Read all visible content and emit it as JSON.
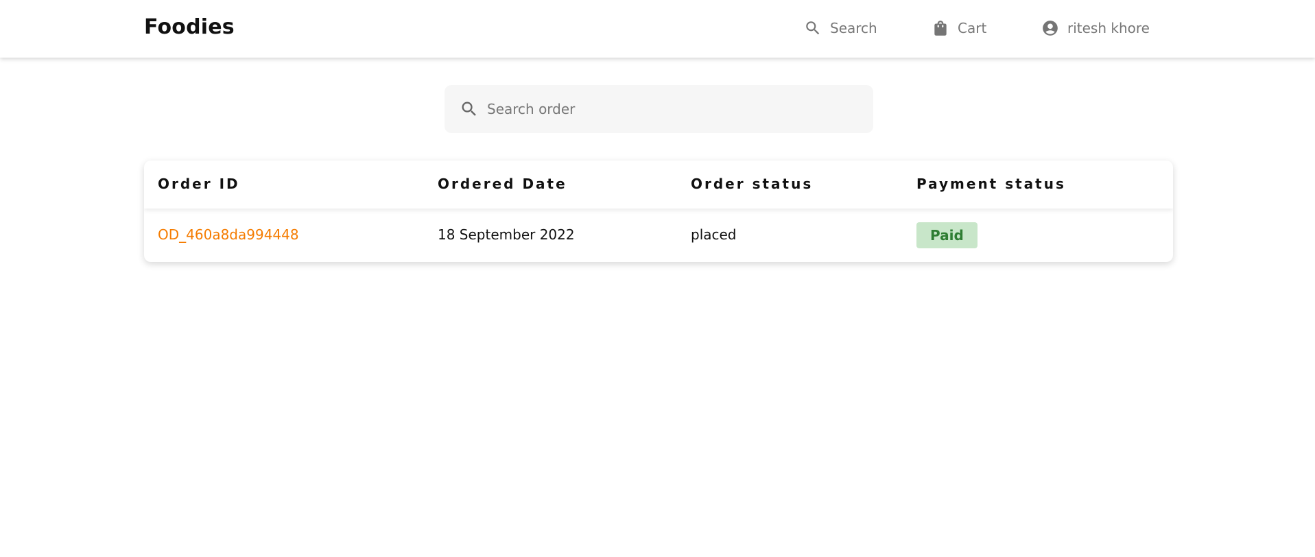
{
  "navbar": {
    "brand": "Foodies",
    "search_label": "Search",
    "cart_label": "Cart",
    "user_name": "ritesh khore",
    "icons": {
      "search": "search-icon",
      "cart": "shopping-bag-icon",
      "profile": "account-circle-icon"
    }
  },
  "search": {
    "placeholder": "Search order",
    "value": ""
  },
  "orders_table": {
    "columns": [
      "Order ID",
      "Ordered Date",
      "Order status",
      "Payment status"
    ],
    "rows": [
      {
        "order_id": "OD_460a8da994448",
        "ordered_date": "18 September 2022",
        "order_status": "placed",
        "payment_status": "Paid"
      }
    ]
  },
  "colors": {
    "link": "#f57c00",
    "badge_bg": "#c8e6c9",
    "badge_text": "#2e7d32",
    "nav_text": "#777777"
  }
}
